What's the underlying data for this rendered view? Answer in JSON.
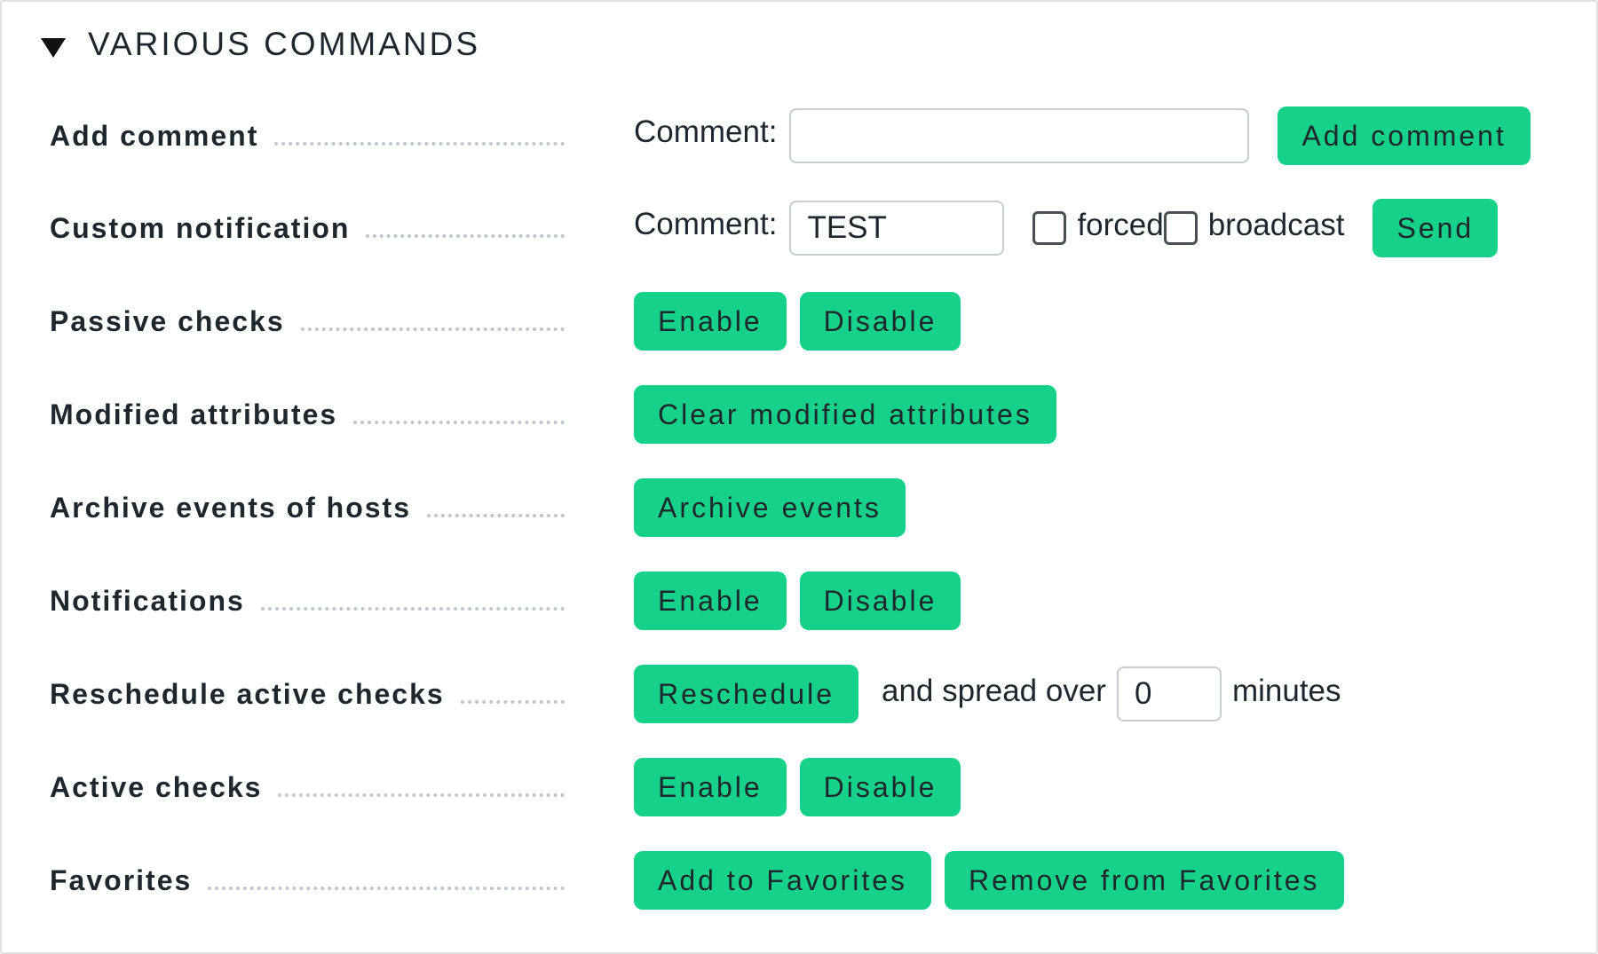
{
  "section": {
    "title": "VARIOUS COMMANDS"
  },
  "rows": {
    "add_comment": {
      "label": "Add comment",
      "comment_label": "Comment:",
      "comment_value": "",
      "button": "Add comment"
    },
    "custom_notification": {
      "label": "Custom notification",
      "comment_label": "Comment:",
      "comment_value": "TEST",
      "forced_label": "forced",
      "broadcast_label": "broadcast",
      "button": "Send"
    },
    "passive_checks": {
      "label": "Passive checks",
      "enable": "Enable",
      "disable": "Disable"
    },
    "modified_attributes": {
      "label": "Modified attributes",
      "button": "Clear modified attributes"
    },
    "archive_events": {
      "label": "Archive events of hosts",
      "button": "Archive events"
    },
    "notifications": {
      "label": "Notifications",
      "enable": "Enable",
      "disable": "Disable"
    },
    "reschedule": {
      "label": "Reschedule active checks",
      "button": "Reschedule",
      "spread_text": "and spread over",
      "spread_value": "0",
      "minutes_text": "minutes"
    },
    "active_checks": {
      "label": "Active checks",
      "enable": "Enable",
      "disable": "Disable"
    },
    "favorites": {
      "label": "Favorites",
      "add": "Add to Favorites",
      "remove": "Remove from Favorites"
    }
  },
  "colors": {
    "button": "#15d18a",
    "text": "#1e262e",
    "border": "#dfe1e5"
  }
}
